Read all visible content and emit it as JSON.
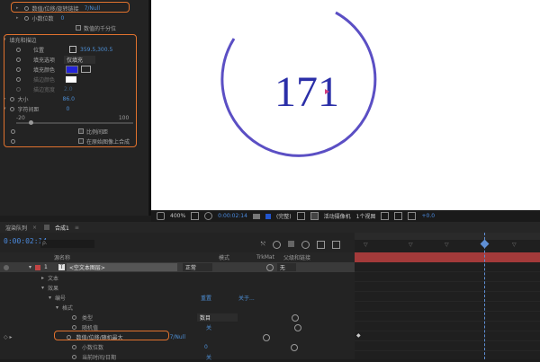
{
  "effect_controls": {
    "rows": [
      {
        "label": "数值/位移/旋转链接",
        "value": "7/Null"
      },
      {
        "label": "小数位数",
        "value": "0"
      },
      {
        "label": "",
        "check_label": "数值的千分位"
      },
      {
        "label": "填充和描边"
      },
      {
        "label": "位置",
        "value": "359.5,300.5"
      },
      {
        "label": "填充选项",
        "value": "仅填充"
      },
      {
        "label": "填充颜色"
      },
      {
        "label": "描边颜色"
      },
      {
        "label": "描边宽度",
        "value": "2.0"
      },
      {
        "label": "大小",
        "value": "86.0"
      },
      {
        "label": "字符间距",
        "value": "0"
      },
      {
        "label": "比例间距",
        "check_label": "比例间距"
      },
      {
        "label": "",
        "check_label": "在原始图像上合成"
      }
    ],
    "scale_min": "-20",
    "scale_max": "100"
  },
  "composition": {
    "counter_value": "171",
    "ring_color": "#5b4fc4",
    "text_color": "#2b2fa8"
  },
  "viewer_bar": {
    "zoom": "400%",
    "timecode": "0:00:02:14",
    "resolution": "(完整)",
    "camera": "活动摄像机",
    "views": "1个视图",
    "offset": "+0.0"
  },
  "timeline": {
    "tabs": [
      "渲染队列",
      "合成1"
    ],
    "timecode": "0:00:02:14",
    "search_placeholder": "ρ.",
    "columns": {
      "source_name": "源名称",
      "mode": "模式",
      "trkmat": "TrkMat",
      "parent": "父级和链接"
    },
    "layer": {
      "number": "1",
      "name": "<空文本图层>",
      "mode": "正常",
      "parent": "无"
    },
    "tree": [
      {
        "label": "文本",
        "indent": 1
      },
      {
        "label": "效果",
        "indent": 1
      },
      {
        "label": "编号",
        "indent": 2,
        "reset": "重置",
        "extra": "关于..."
      },
      {
        "label": "格式",
        "indent": 3
      },
      {
        "label": "类型",
        "indent": 4,
        "value": "数目"
      },
      {
        "label": "随机值",
        "indent": 4,
        "value": "关"
      },
      {
        "label": "数值/位移/随机最大",
        "indent": 4,
        "value": "7/Null"
      },
      {
        "label": "小数位数",
        "indent": 4,
        "value": "0"
      },
      {
        "label": "当前时间/日期",
        "indent": 4,
        "value": "关"
      }
    ],
    "accent": "#e0722e",
    "bar_color": "#a33a3a"
  }
}
